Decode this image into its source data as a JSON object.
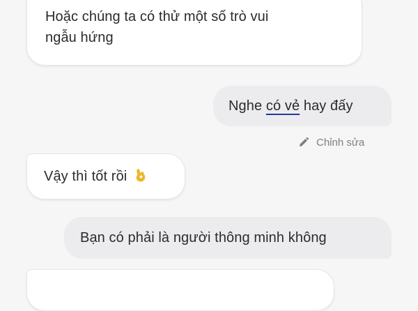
{
  "messages": {
    "incoming_1": {
      "line1": "Hoặc chúng ta có thử một số trò vui",
      "line2": "ngẫu hứng"
    },
    "outgoing_1": {
      "before": "Nghe ",
      "underlined": "có vẻ",
      "after": " hay đấy"
    },
    "edit": {
      "icon": "pencil-icon",
      "label": "Chỉnh sửa"
    },
    "incoming_2": {
      "text": "Vậy thì tốt rồi",
      "emoji": "ok-hand-emoji"
    },
    "outgoing_2": {
      "text": "Bạn có phải là người thông minh không"
    }
  },
  "colors": {
    "background": "#f6f6f6",
    "incoming_bubble": "#ffffff",
    "outgoing_bubble": "#ececee",
    "text": "#2b2b2b",
    "muted_text": "#7f7f7f",
    "underline_accent": "#203a9a",
    "emoji_yellow": "#f2b829"
  }
}
